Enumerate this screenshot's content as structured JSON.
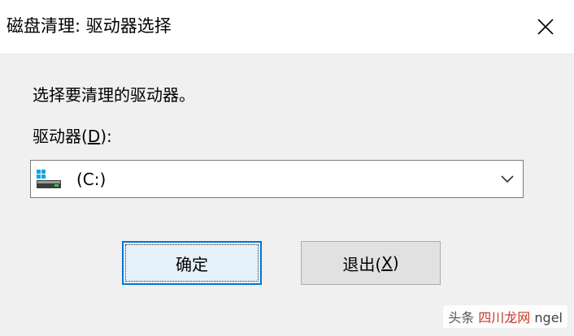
{
  "window": {
    "title": "磁盘清理: 驱动器选择",
    "close_glyph": "✕"
  },
  "dialog": {
    "prompt": "选择要清理的驱动器。",
    "drive_label_prefix": "驱动器(",
    "drive_label_accel": "D",
    "drive_label_suffix": "):",
    "drive_select": {
      "selected_value": "(C:)",
      "icon": "windows-drive-icon",
      "dropdown_icon": "chevron-down-icon"
    }
  },
  "buttons": {
    "ok_label": "确定",
    "exit_label_prefix": "退出(",
    "exit_label_accel": "X",
    "exit_label_suffix": ")"
  },
  "watermark": {
    "brand": "头条",
    "site": "四川龙网",
    "suffix": "ngel"
  },
  "colors": {
    "window_bg": "#f0f0f0",
    "titlebar_bg": "#ffffff",
    "accent": "#0078d7",
    "windows_logo": "#0aa6e0"
  }
}
